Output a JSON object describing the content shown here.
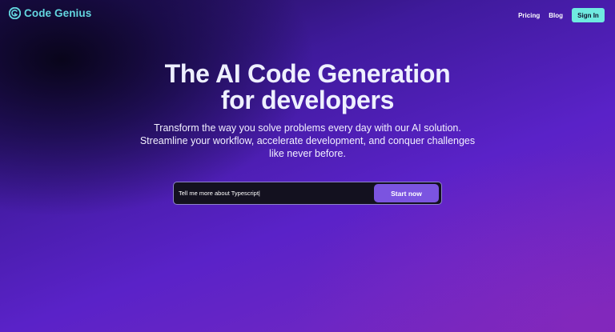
{
  "brand": {
    "name": "Code Genius",
    "icon": "code-genius-logo-icon",
    "color": "#63d6df"
  },
  "nav": {
    "links": [
      "Pricing",
      "Blog"
    ],
    "signin_label": "Sign In",
    "signin_color": "#6fe9e0"
  },
  "hero": {
    "title_line1": "The AI Code Generation",
    "title_line2": "for developers",
    "subtitle_line1": "Transform the way you solve problems every day with our AI solution.",
    "subtitle_line2": "Streamline your workflow, accelerate development, and conquer challenges",
    "subtitle_line3": "like never before."
  },
  "prompt": {
    "value": "Tell me more about Typescript|",
    "button_label": "Start now",
    "button_color": "#7b54e0"
  }
}
